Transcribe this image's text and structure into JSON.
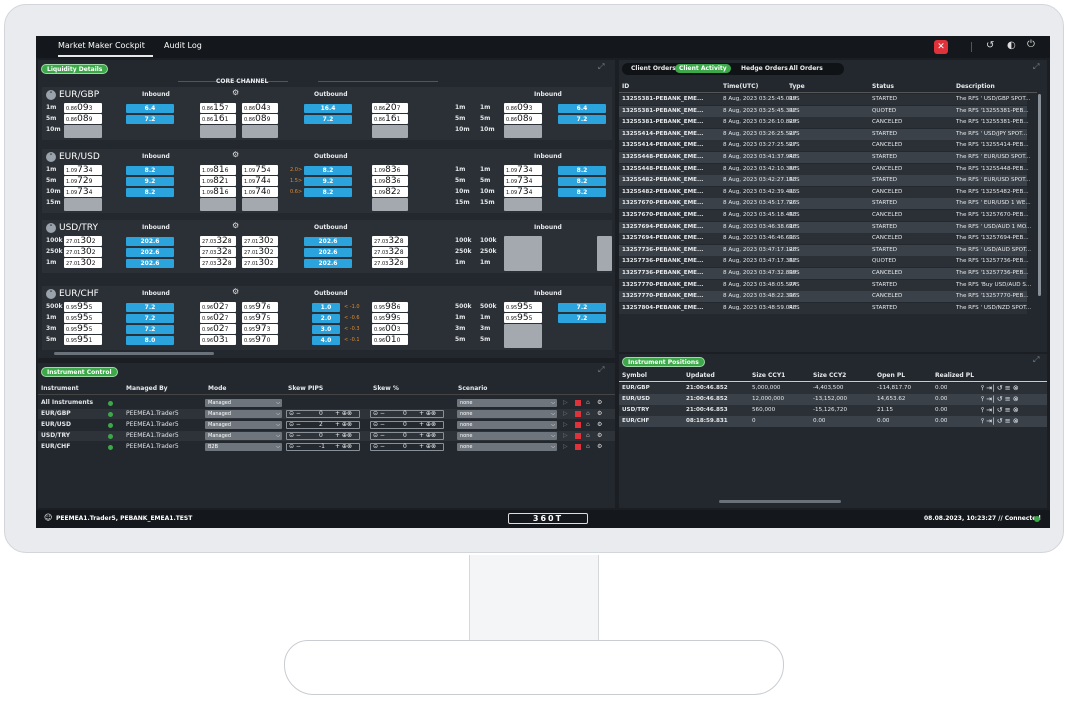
{
  "topbar": {
    "tab1": "Market Maker Cockpit",
    "tab2": "Audit Log",
    "icons": [
      "close-red-icon",
      "history-icon",
      "contrast-icon",
      "power-icon"
    ]
  },
  "liquidity": {
    "label": "Liquidity Details",
    "core": "CORE CHANNEL",
    "inbound": "Inbound",
    "outbound": "Outbound"
  },
  "pairs": [
    {
      "name": "EUR/GBP",
      "tiers": [
        "1m",
        "5m",
        "10m"
      ],
      "left": [
        [
          "0.86",
          "09",
          "3"
        ],
        [
          "0.86",
          "08",
          "9"
        ]
      ],
      "in": [
        "6.4",
        "7.2"
      ],
      "ib": [
        [
          "0.86",
          "15",
          "7"
        ],
        [
          "0.86",
          "16",
          "1"
        ]
      ],
      "ob": [
        [
          "0.86",
          "04",
          "3"
        ],
        [
          "0.86",
          "08",
          "9"
        ]
      ],
      "out": [
        "16.4",
        "7.2"
      ],
      "ob2": [
        [
          "0.86",
          "20",
          "7"
        ],
        [
          "0.86",
          "16",
          "1"
        ]
      ],
      "tr": [
        "1m",
        "5m",
        "10m"
      ],
      "rt": [
        "1m",
        "5m",
        "10m"
      ],
      "r2": [
        [
          "0.86",
          "09",
          "3"
        ],
        [
          "0.86",
          "08",
          "9"
        ]
      ],
      "rin": [
        "6.4",
        "7.2"
      ]
    },
    {
      "name": "EUR/USD",
      "tiers": [
        "1m",
        "5m",
        "10m",
        "15m"
      ],
      "left": [
        [
          "1.09",
          "73",
          "4"
        ],
        [
          "1.09",
          "72",
          "9"
        ],
        [
          "1.09",
          "73",
          "4"
        ]
      ],
      "in": [
        "8.2",
        "9.2",
        "8.2"
      ],
      "ib": [
        [
          "1.09",
          "81",
          "6"
        ],
        [
          "1.09",
          "82",
          "1"
        ],
        [
          "1.09",
          "81",
          "6"
        ]
      ],
      "ob": [
        [
          "1.09",
          "75",
          "4"
        ],
        [
          "1.09",
          "74",
          "4"
        ],
        [
          "1.09",
          "74",
          "0"
        ]
      ],
      "out": [
        "8.2",
        "9.2",
        "8.2"
      ],
      "skew": [
        "2.0>",
        "1.5>",
        "0.6>"
      ],
      "ob2": [
        [
          "1.09",
          "83",
          "6"
        ],
        [
          "1.09",
          "83",
          "6"
        ],
        [
          "1.09",
          "82",
          "2"
        ]
      ],
      "tr": [
        "1m",
        "5m",
        "10m",
        "15m"
      ],
      "rt": [
        "1m",
        "5m",
        "10m",
        "15m"
      ],
      "r2": [
        [
          "1.09",
          "73",
          "4"
        ],
        [
          "1.09",
          "73",
          "4"
        ],
        [
          "1.09",
          "73",
          "4"
        ]
      ],
      "rin": [
        "8.2",
        "8.2",
        "8.2"
      ]
    },
    {
      "name": "USD/TRY",
      "tiers": [
        "100k",
        "250k",
        "1m"
      ],
      "left": [
        [
          "27.01",
          "30",
          "2"
        ],
        [
          "27.01",
          "30",
          "2"
        ],
        [
          "27.01",
          "30",
          "2"
        ]
      ],
      "in": [
        "202.6",
        "202.6",
        "202.6"
      ],
      "ib": [
        [
          "27.03",
          "32",
          "8"
        ],
        [
          "27.03",
          "32",
          "8"
        ],
        [
          "27.03",
          "32",
          "8"
        ]
      ],
      "ob": [
        [
          "27.01",
          "30",
          "2"
        ],
        [
          "27.01",
          "30",
          "2"
        ],
        [
          "27.01",
          "30",
          "2"
        ]
      ],
      "out": [
        "202.6",
        "202.6",
        "202.6"
      ],
      "ob2": [
        [
          "27.03",
          "32",
          "8"
        ],
        [
          "27.03",
          "32",
          "8"
        ],
        [
          "27.03",
          "32",
          "8"
        ]
      ],
      "tr": [
        "100k",
        "250k",
        "1m"
      ],
      "rt": [
        "100k",
        "250k",
        "1m"
      ]
    },
    {
      "name": "EUR/CHF",
      "tiers": [
        "500k",
        "1m",
        "3m",
        "5m"
      ],
      "left": [
        [
          "0.95",
          "95",
          "5"
        ],
        [
          "0.95",
          "95",
          "5"
        ],
        [
          "0.95",
          "95",
          "5"
        ],
        [
          "0.95",
          "95",
          "1"
        ]
      ],
      "in": [
        "7.2",
        "7.2",
        "7.2",
        "8.0"
      ],
      "ib": [
        [
          "0.96",
          "02",
          "7"
        ],
        [
          "0.96",
          "02",
          "7"
        ],
        [
          "0.96",
          "02",
          "7"
        ],
        [
          "0.96",
          "03",
          "1"
        ]
      ],
      "ob": [
        [
          "0.95",
          "97",
          "6"
        ],
        [
          "0.95",
          "97",
          "5"
        ],
        [
          "0.95",
          "97",
          "3"
        ],
        [
          "0.95",
          "97",
          "0"
        ]
      ],
      "out": [
        "1.0",
        "2.0",
        "3.0",
        "4.0"
      ],
      "skew": [
        "< -1.0",
        "< -0.6",
        "< -0.3",
        "< -0.1"
      ],
      "ob2": [
        [
          "0.95",
          "98",
          "6"
        ],
        [
          "0.95",
          "99",
          "5"
        ],
        [
          "0.96",
          "00",
          "3"
        ],
        [
          "0.96",
          "01",
          "0"
        ]
      ],
      "tr": [
        "500k",
        "1m",
        "3m",
        "5m"
      ],
      "rt": [
        "500k",
        "1m",
        "3m",
        "5m"
      ],
      "r2": [
        [
          "0.95",
          "95",
          "5"
        ],
        [
          "0.95",
          "95",
          "5"
        ]
      ],
      "rin": [
        "7.2",
        "7.2"
      ]
    }
  ],
  "instrumentControl": {
    "label": "Instrument Control",
    "headers": [
      "Instrument",
      "Managed By",
      "Mode",
      "Skew PIPS",
      "Skew %",
      "Scenario"
    ],
    "rows": [
      {
        "inst": "All Instruments",
        "by": "",
        "mode": "Managed",
        "sp": "",
        "spc": "",
        "sc": "none"
      },
      {
        "inst": "EUR/GBP",
        "by": "PEEMEA1.Trader5",
        "mode": "Managed",
        "sp": "0",
        "spc": "0",
        "sc": "none"
      },
      {
        "inst": "EUR/USD",
        "by": "PEEMEA1.Trader5",
        "mode": "Managed",
        "sp": "2",
        "spc": "0",
        "sc": "none"
      },
      {
        "inst": "USD/TRY",
        "by": "PEEMEA1.Trader5",
        "mode": "Managed",
        "sp": "0",
        "spc": "0",
        "sc": "none"
      },
      {
        "inst": "EUR/CHF",
        "by": "PEEMEA1.Trader5",
        "mode": "B2B",
        "sp": "-1",
        "spc": "0",
        "sc": "none"
      }
    ]
  },
  "orders": {
    "tabs": [
      "Client Orders",
      "Client Activity",
      "Hedge Orders",
      "All Orders"
    ],
    "headers": [
      "ID",
      "Time(UTC)",
      "Type",
      "Status",
      "Description"
    ],
    "rows": [
      [
        "13255381-PEBANK_EME...",
        "8 Aug, 2023 03:25:45.019",
        "RFS",
        "STARTED",
        "The RFS ' USD/GBP SPOT..."
      ],
      [
        "13255381-PEBANK_EME...",
        "8 Aug, 2023 03:25:45.332",
        "RFS",
        "QUOTED",
        "The RFS '13255381-PEB..."
      ],
      [
        "13255381-PEBANK_EME...",
        "8 Aug, 2023 03:26:10.829",
        "RFS",
        "CANCELED",
        "The RFS '13255381-PEB..."
      ],
      [
        "13255414-PEBANK_EME...",
        "8 Aug, 2023 03:26:25.527",
        "RFS",
        "STARTED",
        "The RFS ' USD/JPY SPOT..."
      ],
      [
        "13255414-PEBANK_EME...",
        "8 Aug, 2023 03:27:25.527",
        "RFS",
        "CANCELED",
        "The RFS '13255414-PEB..."
      ],
      [
        "13255448-PEBANK_EME...",
        "8 Aug, 2023 03:41:37.948",
        "RFS",
        "STARTED",
        "The RFS ' EUR/USD SPOT..."
      ],
      [
        "13255448-PEBANK_EME...",
        "8 Aug, 2023 03:42:10.380",
        "RFS",
        "CANCELED",
        "The RFS '13255448-PEB..."
      ],
      [
        "13255482-PEBANK_EME...",
        "8 Aug, 2023 03:42:27.163",
        "RFS",
        "STARTED",
        "The RFS ' EUR/USD SPOT..."
      ],
      [
        "13255482-PEBANK_EME...",
        "8 Aug, 2023 03:42:39.435",
        "RFS",
        "CANCELED",
        "The RFS '13255482-PEB..."
      ],
      [
        "13257670-PEBANK_EME...",
        "8 Aug, 2023 03:45:17.726",
        "RFS",
        "STARTED",
        "The RFS ' EUR/USD 1 WE..."
      ],
      [
        "13257670-PEBANK_EME...",
        "8 Aug, 2023 03:45:18.463",
        "RFS",
        "CANCELED",
        "The RFS '13257670-PEB..."
      ],
      [
        "13257694-PEBANK_EME...",
        "8 Aug, 2023 03:46:38.610",
        "RFS",
        "STARTED",
        "The RFS ' USD/AUD 1 MO..."
      ],
      [
        "13257694-PEBANK_EME...",
        "8 Aug, 2023 03:46:46.695",
        "RFS",
        "CANCELED",
        "The RFS '13257694-PEB..."
      ],
      [
        "13257736-PEBANK_EME...",
        "8 Aug, 2023 03:47:17.128",
        "RFS",
        "STARTED",
        "The RFS ' USD/AUD SPOT..."
      ],
      [
        "13257736-PEBANK_EME...",
        "8 Aug, 2023 03:47:17.362",
        "RFS",
        "QUOTED",
        "The RFS '13257736-PEB..."
      ],
      [
        "13257736-PEBANK_EME...",
        "8 Aug, 2023 03:47:32.899",
        "RFS",
        "CANCELED",
        "The RFS '13257736-PEB..."
      ],
      [
        "13257770-PEBANK_EME...",
        "8 Aug, 2023 03:48:05.574",
        "RFS",
        "STARTED",
        "The RFS 'Buy USD/AUD S..."
      ],
      [
        "13257770-PEBANK_EME...",
        "8 Aug, 2023 03:48:22.396",
        "RFS",
        "CANCELED",
        "The RFS '13257770-PEB..."
      ],
      [
        "13257804-PEBANK_EME...",
        "8 Aug, 2023 03:48:59.048",
        "RFS",
        "STARTED",
        "The RFS ' USD/NZD SPOT..."
      ]
    ]
  },
  "positions": {
    "label": "Instrument Positions",
    "headers": [
      "Symbol",
      "Updated",
      "Size CCY1",
      "Size CCY2",
      "Open PL",
      "Realized PL"
    ],
    "rows": [
      [
        "EUR/GBP",
        "21:00:46.852",
        "5,000,000",
        "-4,403,500",
        "-114,817.70",
        "0.00"
      ],
      [
        "EUR/USD",
        "21:00:46.852",
        "12,000,000",
        "-13,152,000",
        "14,653.62",
        "0.00"
      ],
      [
        "USD/TRY",
        "21:00:46.853",
        "560,000",
        "-15,126,720",
        "21.15",
        "0.00"
      ],
      [
        "EUR/CHF",
        "08:18:59.831",
        "0",
        "0.00",
        "0.00",
        "0.00"
      ]
    ]
  },
  "status": {
    "user": "PEEMEA1.Trader5, PEBANK_EMEA1.TEST",
    "logo": "360T",
    "right": "08.08.2023, 10:23:27 // Connected"
  }
}
